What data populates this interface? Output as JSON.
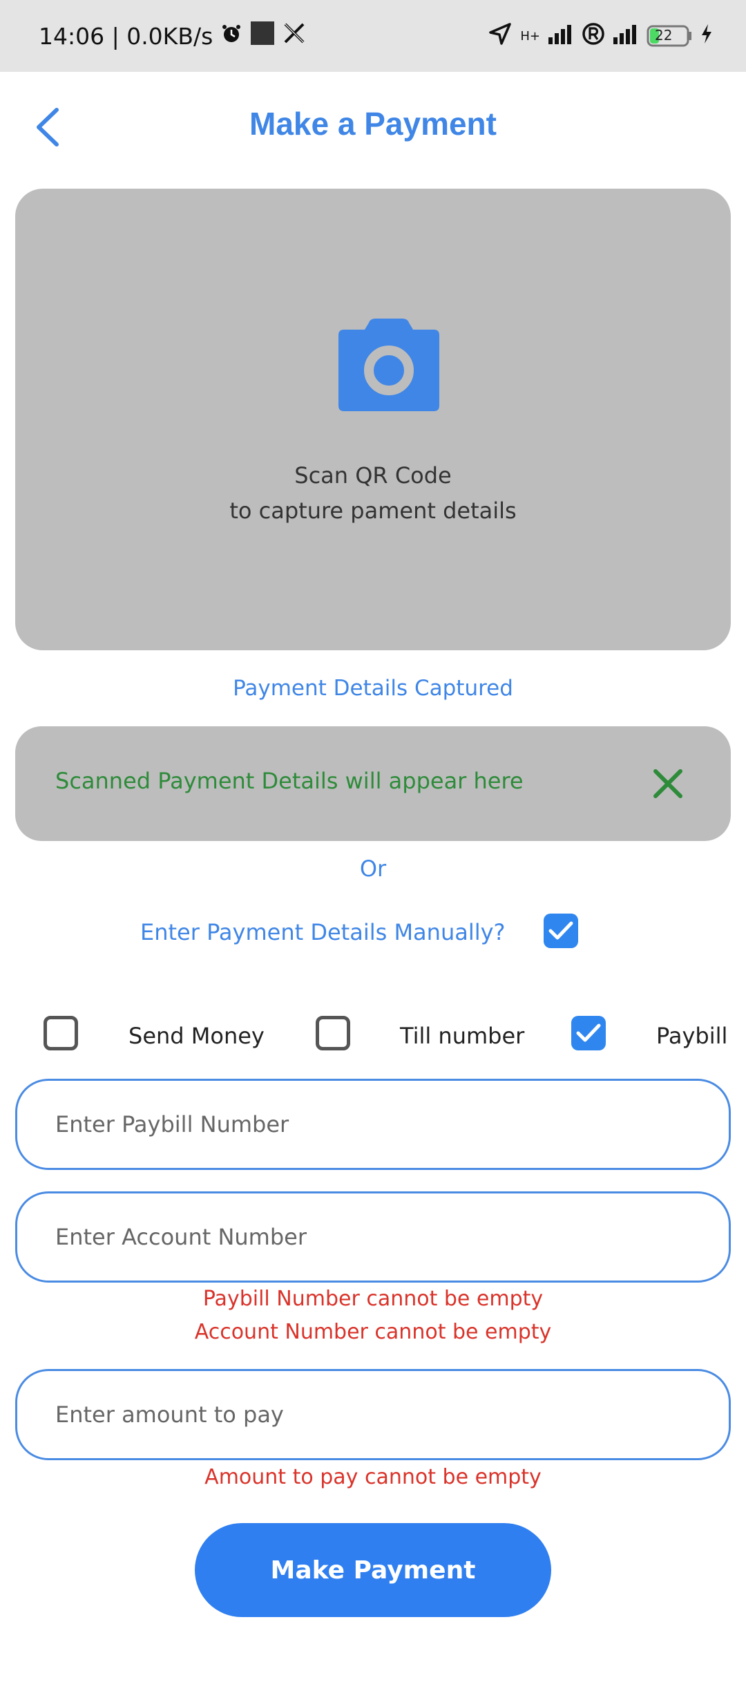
{
  "status_bar": {
    "time_speed": "14:06 | 0.0KB/s",
    "network_label": "H+",
    "battery": "22"
  },
  "header": {
    "title": "Make a Payment"
  },
  "scanner": {
    "title": "Scan QR Code",
    "subtitle": "to capture pament details"
  },
  "captured_label": "Payment Details Captured",
  "scanned_details": {
    "text": "Scanned Payment Details will appear here"
  },
  "or_label": "Or",
  "manual": {
    "label": "Enter Payment Details Manually?",
    "checked": true
  },
  "payment_types": [
    {
      "label": "Send Money",
      "checked": false
    },
    {
      "label": "Till number",
      "checked": false
    },
    {
      "label": "Paybill",
      "checked": true
    }
  ],
  "fields": {
    "paybill": {
      "placeholder": "Enter Paybill Number",
      "value": ""
    },
    "account": {
      "placeholder": "Enter Account Number",
      "value": ""
    },
    "amount": {
      "placeholder": "Enter amount to pay",
      "value": ""
    }
  },
  "errors": {
    "paybill": "Paybill Number cannot be empty",
    "account": "Account Number cannot be empty",
    "amount": "Amount to pay cannot be empty"
  },
  "submit_label": "Make Payment",
  "colors": {
    "accent": "#3f86e6",
    "button": "#2f7ff0",
    "error": "#d9332a",
    "success_text": "#2e8b3a",
    "card": "#bdbdbd"
  }
}
